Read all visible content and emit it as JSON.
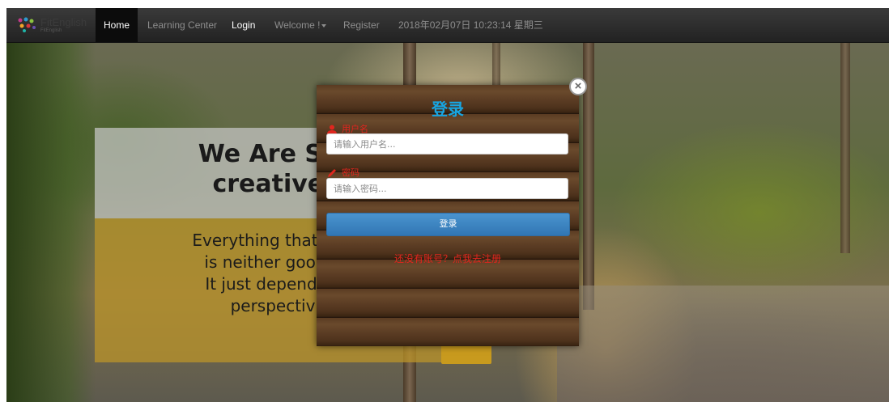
{
  "navbar": {
    "brand": {
      "name": "FitEnglish",
      "tagline": "FitEnglish"
    },
    "items": [
      {
        "label": "Home",
        "active": true
      },
      {
        "label": "Learning Center"
      },
      {
        "label": "Login"
      },
      {
        "label": "Welcome !"
      },
      {
        "label": "Register"
      }
    ],
    "datetime": "2018年02月07日 10:23:14 星期三"
  },
  "hero": {
    "title": "We Are Sm\ncreative.",
    "body": "Everything that hap\nis neither good n\nIt just depends o\nperspectiv"
  },
  "login_modal": {
    "title": "登录",
    "username": {
      "label": "用户名",
      "placeholder": "请输入用户名..."
    },
    "password": {
      "label": "密码",
      "placeholder": "请输入密码..."
    },
    "submit_label": "登录",
    "register_link": "还没有账号？点我去注册",
    "close_symbol": "×"
  },
  "colors": {
    "title_blue": "#17a6e3",
    "label_red": "#e0261e",
    "button_blue": "#3a84c2",
    "navbar_dark": "#222222"
  }
}
